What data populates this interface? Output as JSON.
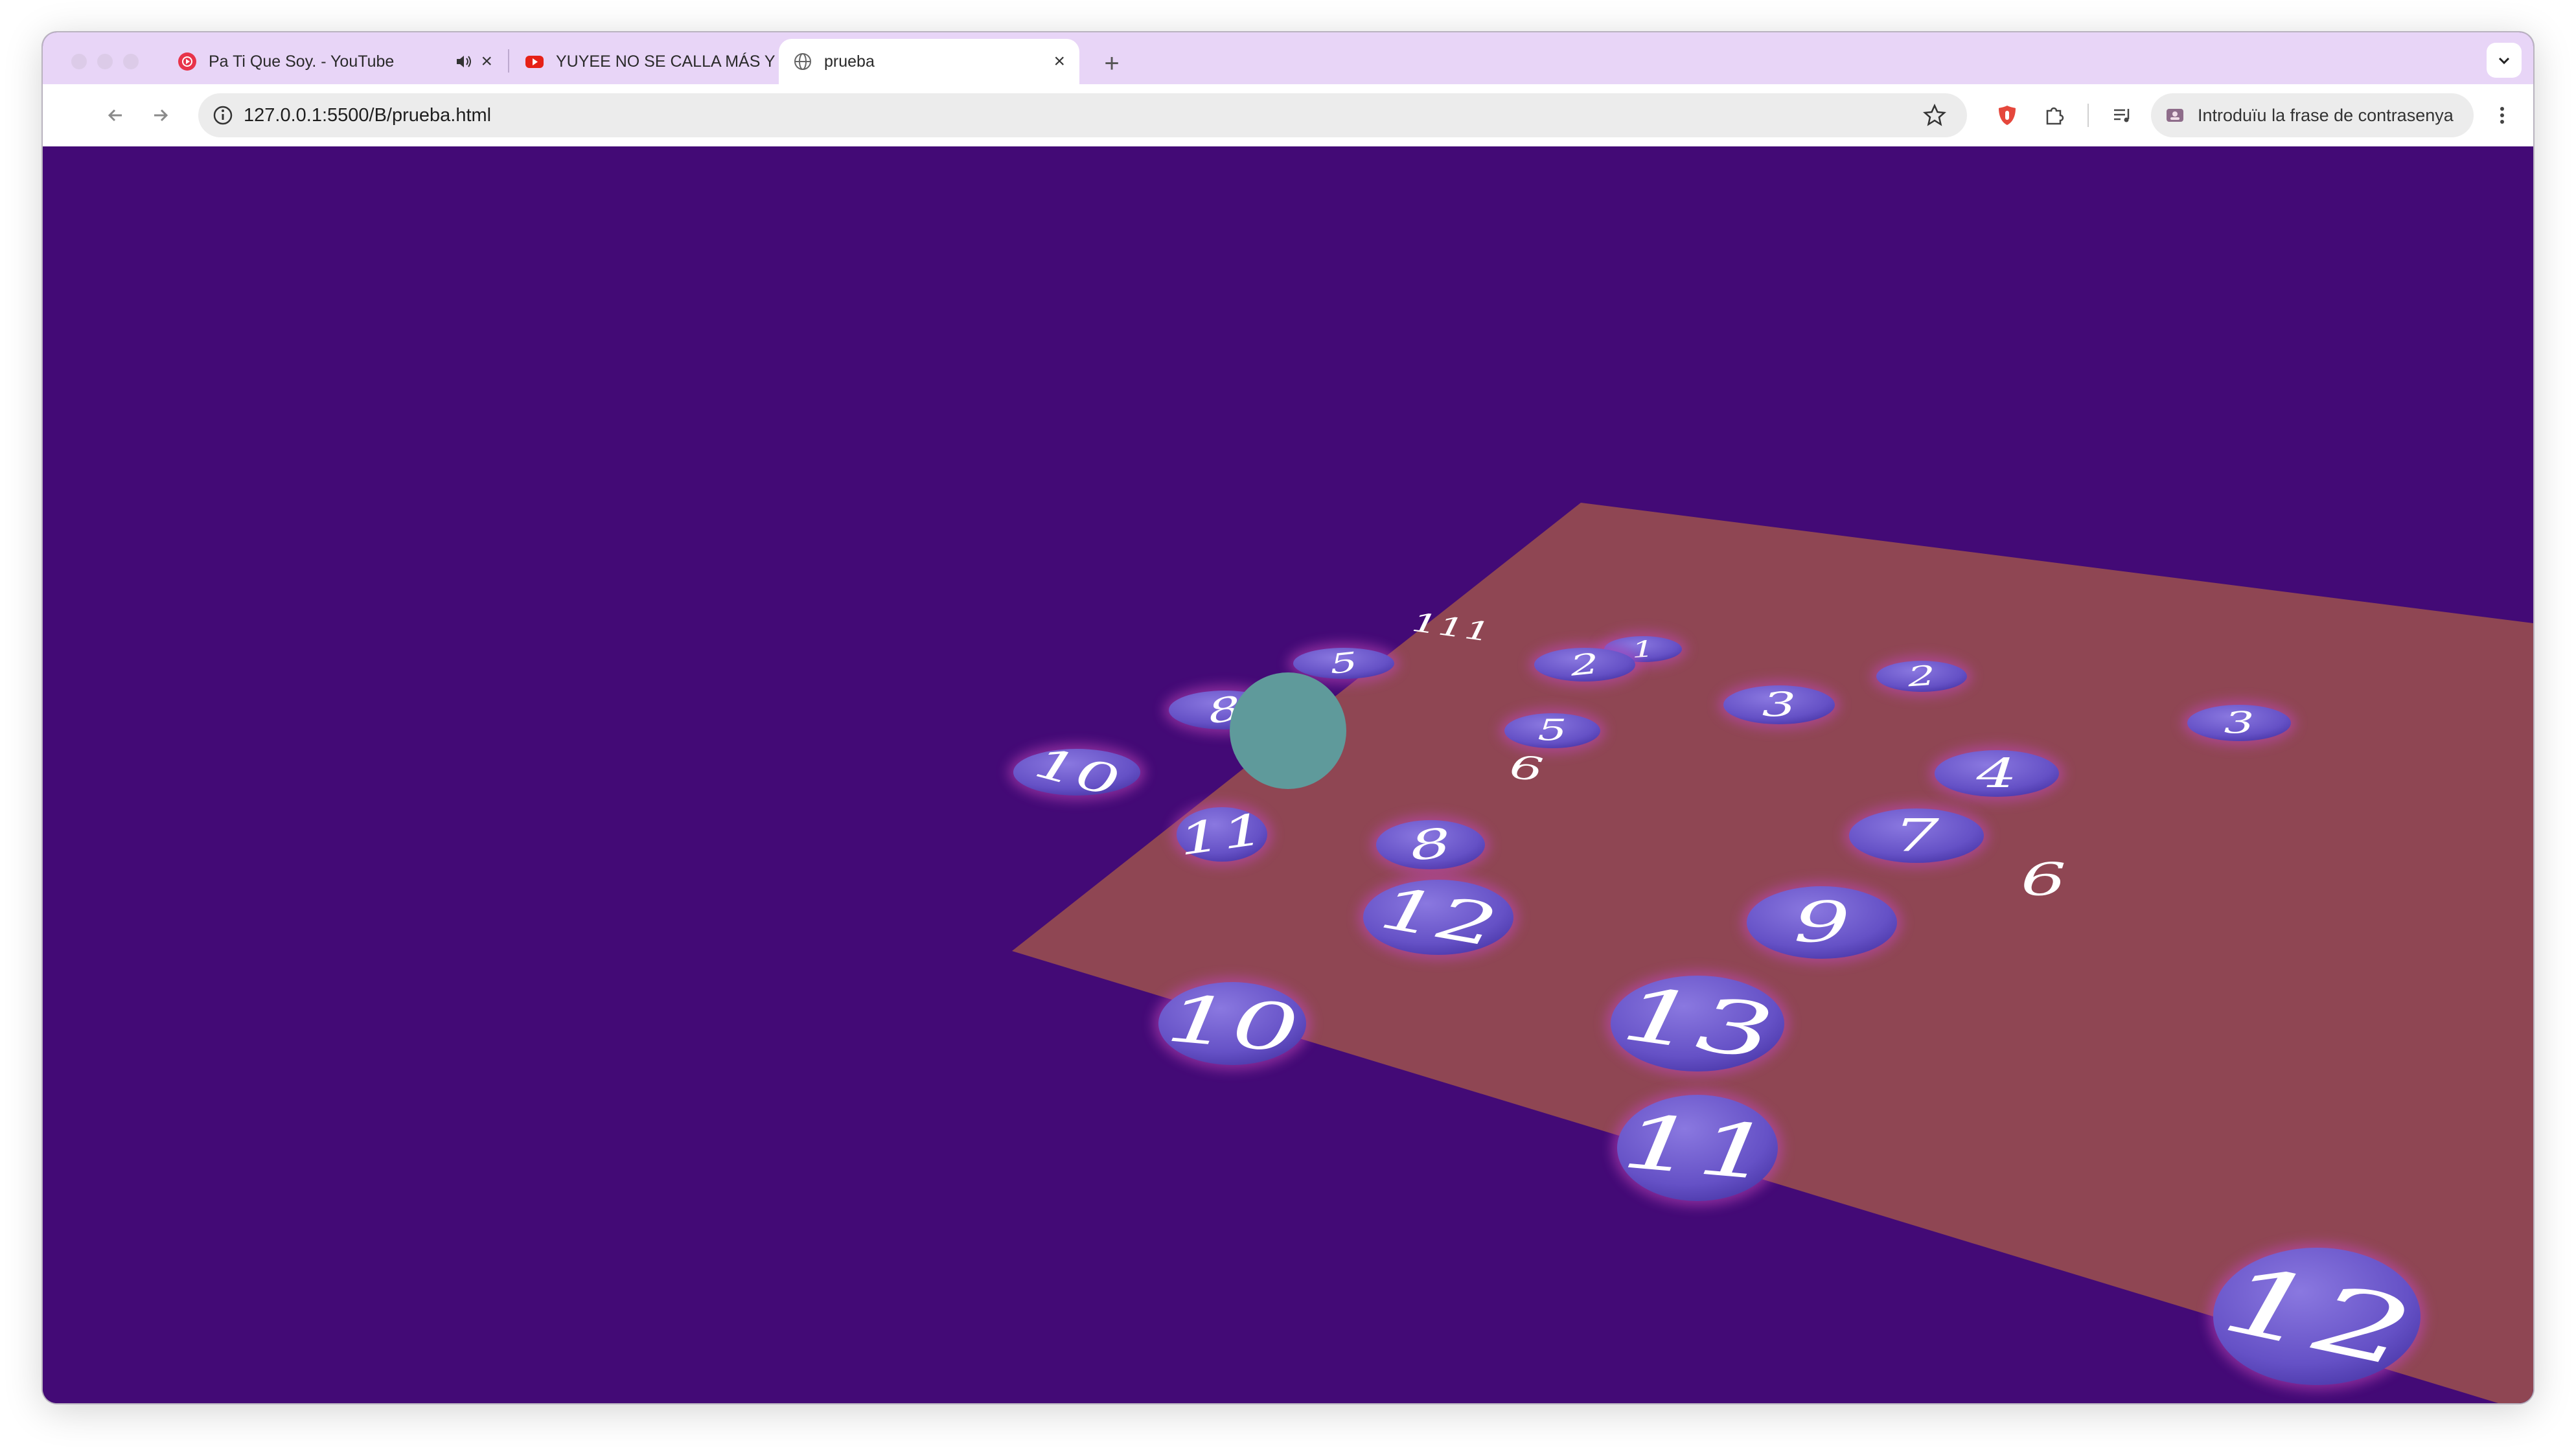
{
  "browser": {
    "tabs": [
      {
        "title": "Pa Ti Que Soy. - YouTube",
        "icon": "youtube-music-icon",
        "audio": true,
        "active": false
      },
      {
        "title": "YUYEE NO SE CALLA MÁS Y",
        "icon": "youtube-icon",
        "audio": false,
        "active": false
      },
      {
        "title": "prueba",
        "icon": "globe-icon",
        "audio": false,
        "active": true
      }
    ],
    "url": "127.0.0.1:5500/B/prueba.html",
    "password_prompt": "Introduïu la frase de contrasenya"
  },
  "scene": {
    "background_color": "#430a76",
    "board_color": "#8f4653",
    "disc_color": "#6750c8",
    "player_color": "#5f9a9b",
    "tokens": [
      {
        "label": "111",
        "on_board": false
      },
      {
        "label": "5",
        "on_board": false
      },
      {
        "label": "8",
        "on_board": false
      },
      {
        "label": "10",
        "on_board": false
      },
      {
        "label": "11",
        "on_board": false
      },
      {
        "label": "1",
        "on_board": true
      },
      {
        "label": "2",
        "on_board": true
      },
      {
        "label": "3",
        "on_board": true
      },
      {
        "label": "2",
        "on_board": true
      },
      {
        "label": "3",
        "on_board": true
      },
      {
        "label": "5",
        "on_board": true
      },
      {
        "label": "6",
        "on_board": true
      },
      {
        "label": "4",
        "on_board": true
      },
      {
        "label": "7",
        "on_board": true
      },
      {
        "label": "6",
        "on_board": true
      },
      {
        "label": "8",
        "on_board": true
      },
      {
        "label": "12",
        "on_board": true
      },
      {
        "label": "9",
        "on_board": true
      },
      {
        "label": "10",
        "on_board": true
      },
      {
        "label": "13",
        "on_board": true
      },
      {
        "label": "11",
        "on_board": true
      },
      {
        "label": "12",
        "on_board": true
      }
    ]
  }
}
